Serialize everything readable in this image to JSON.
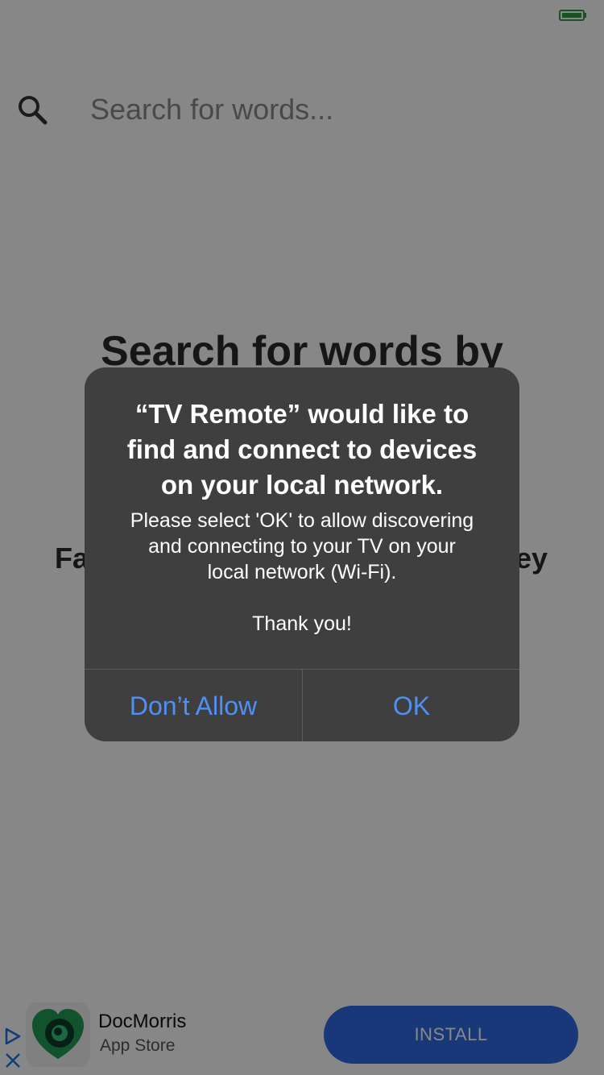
{
  "search": {
    "placeholder": "Search for words..."
  },
  "hero": {
    "title_visible": "Search for words by",
    "left_fragment": "Fa",
    "right_fragment": "ey"
  },
  "alert": {
    "title": "“TV Remote” would like to\nfind and connect to devices\non your local network.",
    "message": "Please select 'OK' to allow discovering\nand connecting to your TV on your\nlocal network (Wi-Fi).\n\nThank you!",
    "deny_label": "Don’t Allow",
    "ok_label": "OK"
  },
  "ad": {
    "app_name": "DocMorris",
    "store": "App Store",
    "install_label": "INSTALL",
    "icons": [
      "ad-choices-icon",
      "close-icon",
      "docmorris-logo-icon"
    ]
  },
  "colors": {
    "alert_background": "#3f3f3f",
    "alert_button_text": "#4f90f4",
    "install_button": "#2f6ae6",
    "status_indicator": "#2e9b3e"
  }
}
